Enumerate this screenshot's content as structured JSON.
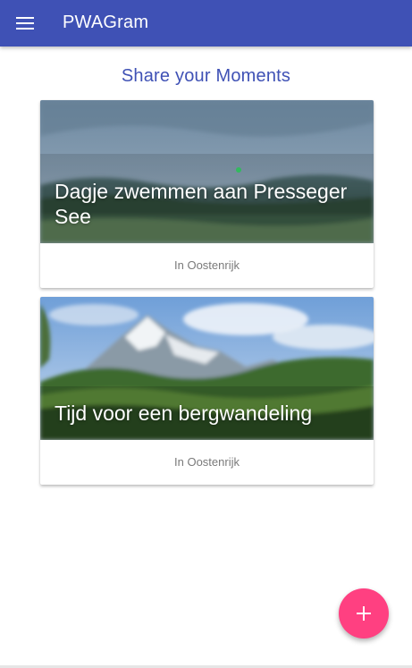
{
  "app": {
    "title": "PWAGram",
    "menu_icon": "menu-icon",
    "primary_color": "#3f51b5",
    "accent_color": "#ff4081"
  },
  "main": {
    "heading": "Share your Moments",
    "cards": [
      {
        "title": "Dagje zwemmen aan Presseger See",
        "location": "In Oostenrijk",
        "image": "lake-photo"
      },
      {
        "title": "Tijd voor een bergwandeling",
        "location": "In Oostenrijk",
        "image": "mountain-photo"
      }
    ]
  },
  "fab": {
    "icon": "plus-icon"
  }
}
